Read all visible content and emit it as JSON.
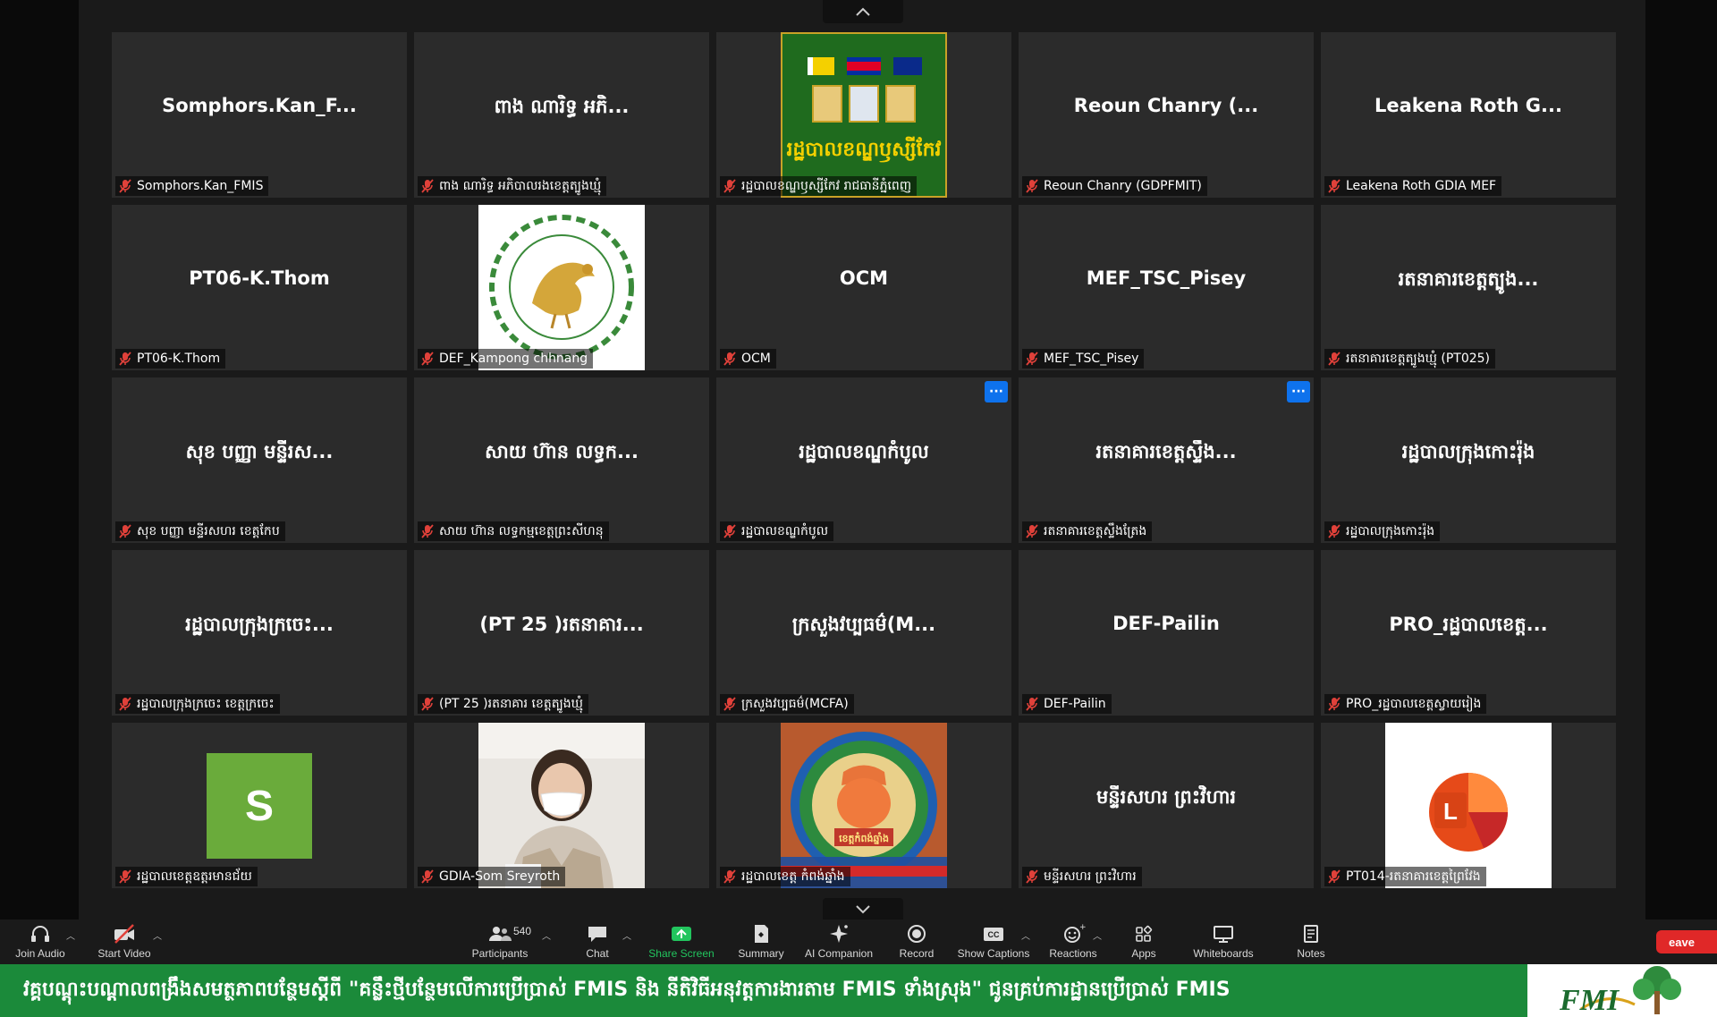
{
  "tiles": [
    {
      "name": "Somphors.Kan_F...",
      "label": "Somphors.Kan_FMIS"
    },
    {
      "name": "ពាង ណារិទ្ធ អភិ...",
      "label": "ពាង ណារិទ្ធ អភិបាលរងខេត្តត្បូងឃ្មុំ"
    },
    {
      "name": "",
      "label": "រដ្ឋបាលខណ្ឌឫស្សីកែវ រាជធានីភ្នំពេញ",
      "image": "khan-russey-keo-emblem",
      "image_text": "រដ្ឋបាលខណ្ឌឫស្សីកែវ"
    },
    {
      "name": "Reoun Chanry (...",
      "label": "Reoun Chanry (GDPFMIT)"
    },
    {
      "name": "Leakena Roth G...",
      "label": "Leakena Roth GDIA MEF"
    },
    {
      "name": "PT06-K.Thom",
      "label": "PT06-K.Thom"
    },
    {
      "name": "",
      "label": "DEF_Kampong chhnang",
      "image": "golden-bird-emblem"
    },
    {
      "name": "OCM",
      "label": "OCM"
    },
    {
      "name": "MEF_TSC_Pisey",
      "label": "MEF_TSC_Pisey"
    },
    {
      "name": "រតនាគារខេត្តត្បូង...",
      "label": "រតនាគារខេត្តត្បូងឃ្មុំ (PT025)"
    },
    {
      "name": "សុខ បញ្ញា មន្ទីរស...",
      "label": "សុខ បញ្ញា មន្ទីរសហរ ខេត្តកែប"
    },
    {
      "name": "សាយ ហ៊ាន លទ្ធក...",
      "label": "សាយ ហ៊ាន លទ្ធកម្មខេត្តព្រះសីហនុ"
    },
    {
      "name": "រដ្ឋបាលខណ្ឌកំបូល",
      "label": "រដ្ឋបាលខណ្ឌកំបូល",
      "more": true
    },
    {
      "name": "រតនាគារខេត្តស្ទឹង...",
      "label": "រតនាគារខេត្តស្ទឹងត្រែង",
      "more": true
    },
    {
      "name": "រដ្ឋបាលក្រុងកោះរ៉ុង",
      "label": "រដ្ឋបាលក្រុងកោះរ៉ុង"
    },
    {
      "name": "រដ្ឋបាលក្រុងក្រចេះ...",
      "label": "រដ្ឋបាលក្រុងក្រចេះ ខេត្តក្រចេះ"
    },
    {
      "name": "(PT 25 )រតនាគារ...",
      "label": "(PT 25 )រតនាគារ ខេត្តត្បូងឃ្មុំ"
    },
    {
      "name": "ក្រសួងវប្បធម៌(M...",
      "label": "ក្រសួងវប្បធម៌(MCFA)"
    },
    {
      "name": "DEF-Pailin",
      "label": "DEF-Pailin"
    },
    {
      "name": "PRO_រដ្ឋបាលខេត្ត...",
      "label": "PRO_រដ្ឋបាលខេត្តស្វាយរៀង"
    },
    {
      "name": "",
      "label": "រដ្ឋបាលខេត្តឧត្តរមានជ័យ",
      "avatar": "S"
    },
    {
      "name": "",
      "label": "GDIA-Som Sreyroth",
      "image": "participant-video"
    },
    {
      "name": "",
      "label": "រដ្ឋបាលខេត្ត កំពង់ឆ្នាំង",
      "image": "kampong-chhnang-emblem",
      "image_text": "ខេត្តកំពង់ឆ្នាំង"
    },
    {
      "name": "មន្ទីរសហរ ព្រះវិហារ",
      "label": "មន្ទីរសហរ ព្រះវិហារ"
    },
    {
      "name": "",
      "label": "PT014-រតនាគារខេត្តព្រៃវែង",
      "image": "office-app-icon"
    }
  ],
  "toolbar": {
    "join_audio": "Join Audio",
    "start_video": "Start Video",
    "participants": "Participants",
    "participants_count": "540",
    "chat": "Chat",
    "share_screen": "Share Screen",
    "summary": "Summary",
    "ai_companion": "AI Companion",
    "record": "Record",
    "show_captions": "Show Captions",
    "captions_badge": "CC",
    "reactions": "Reactions",
    "apps": "Apps",
    "whiteboards": "Whiteboards",
    "notes": "Notes",
    "leave": "eave"
  },
  "banner": {
    "text": "វគ្គបណ្តុះបណ្តាលពង្រឹងសមត្ថភាពបន្ថែមស្តីពី \"គន្លឹះថ្មីបន្ថែមលើការប្រើប្រាស់ FMIS និង នីតិវិធីអនុវត្តការងារតាម FMIS ទាំងស្រុង\" ជូនគ្រប់ការដ្ឋានប្រើប្រាស់ FMIS",
    "logo_text": "FMI"
  },
  "colors": {
    "accent_blue": "#0e72ed",
    "share_green": "#22c55e",
    "banner_green": "#1b8a3a",
    "leave_red": "#e02828",
    "mute_red": "#e0413a"
  }
}
